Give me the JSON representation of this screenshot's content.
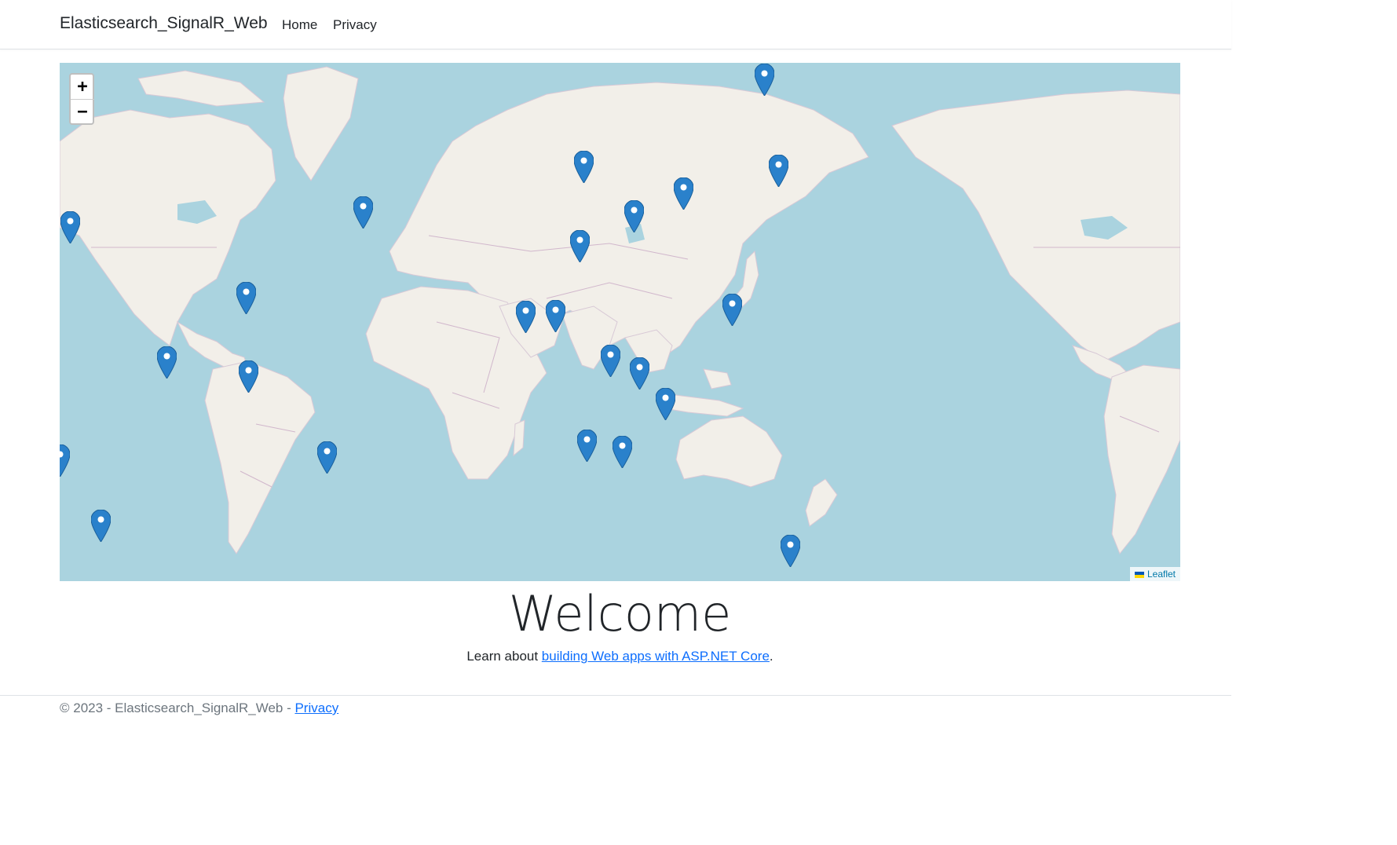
{
  "nav": {
    "brand": "Elasticsearch_SignalR_Web",
    "links": [
      "Home",
      "Privacy"
    ]
  },
  "map": {
    "zoom_in": "+",
    "zoom_out": "−",
    "attribution": "Leaflet",
    "marker_color": "#2a81cb",
    "water_color": "#aad3df",
    "land_color": "#f2efe9",
    "marker_count": 26
  },
  "main": {
    "title": "Welcome",
    "learn_prefix": "Learn about ",
    "learn_link": "building Web apps with ASP.NET Core",
    "learn_suffix": "."
  },
  "footer": {
    "text": "© 2023 - Elasticsearch_SignalR_Web - ",
    "privacy_link": "Privacy"
  }
}
